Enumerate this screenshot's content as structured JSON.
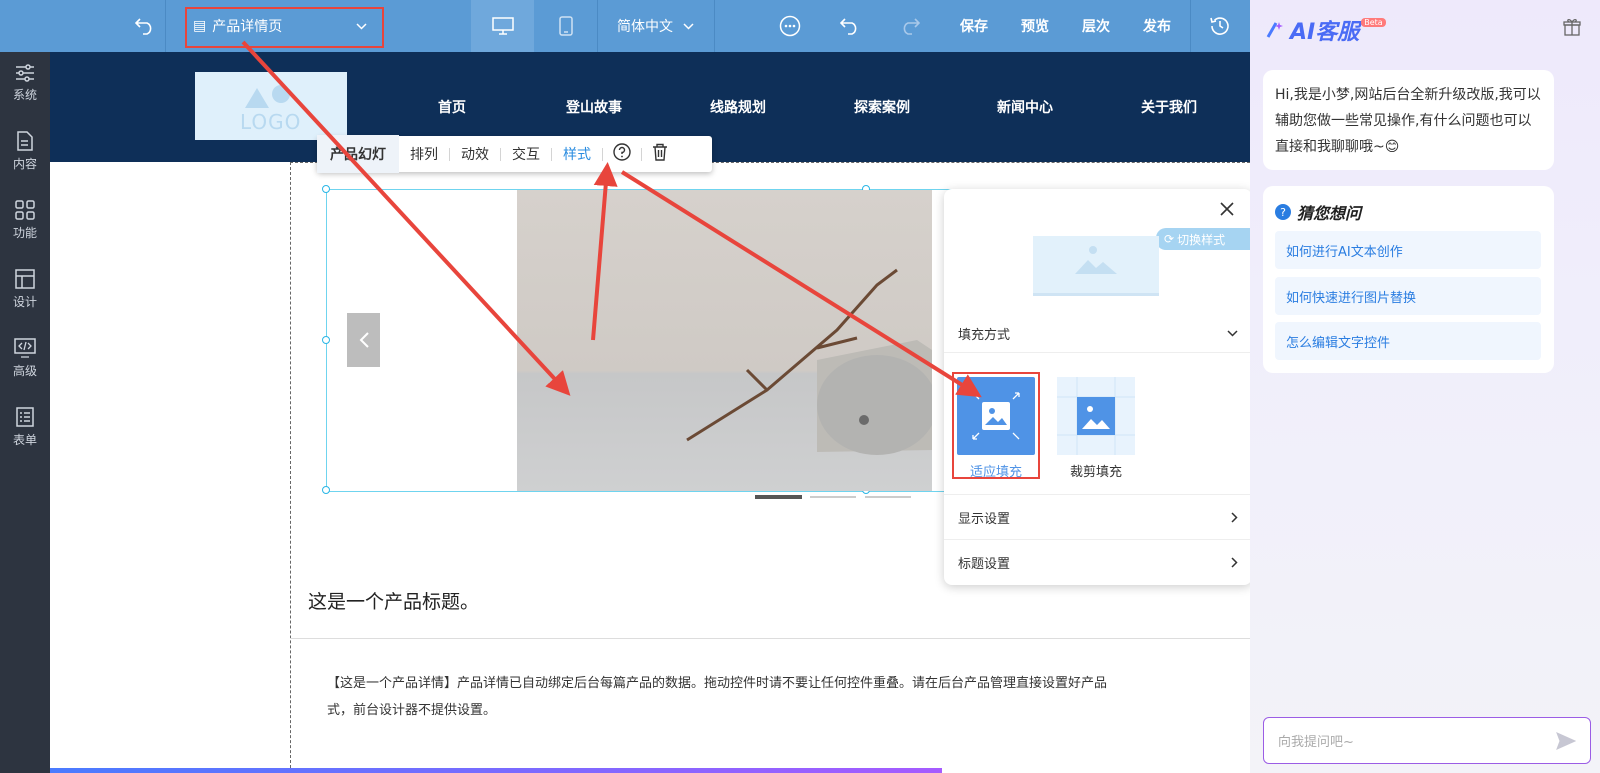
{
  "topbar": {
    "page_select": "产品详情页",
    "language": "简体中文",
    "save": "保存",
    "preview": "预览",
    "layers": "层次",
    "publish": "发布"
  },
  "sidebar": {
    "items": [
      {
        "label": "系统",
        "icon": "sliders-icon"
      },
      {
        "label": "内容",
        "icon": "document-icon"
      },
      {
        "label": "功能",
        "icon": "grid-icon"
      },
      {
        "label": "设计",
        "icon": "layout-icon"
      },
      {
        "label": "高级",
        "icon": "code-icon"
      },
      {
        "label": "表单",
        "icon": "list-icon"
      }
    ]
  },
  "site": {
    "logo": "LOGO",
    "nav": [
      "首页",
      "登山故事",
      "线路规划",
      "探索案例",
      "新闻中心",
      "关于我们"
    ],
    "product_title": "这是一个产品标题。",
    "product_detail_line1": "【这是一个产品详情】产品详情已自动绑定后台每篇产品的数据。拖动控件时请不要让任何控件重叠。请在后台产品管理直接设置好产品",
    "product_detail_line2": "式，前台设计器不提供设置。"
  },
  "toolbar": {
    "items": [
      "产品幻灯",
      "排列",
      "动效",
      "交互",
      "样式"
    ],
    "selected": "产品幻灯",
    "active": "样式"
  },
  "style_panel": {
    "switch_style": "切换样式",
    "fill_mode_label": "填充方式",
    "option_fit": "适应填充",
    "option_crop": "裁剪填充",
    "display_settings": "显示设置",
    "title_settings": "标题设置"
  },
  "ai": {
    "title": "AI客服",
    "badge": "Beta",
    "greeting": "Hi,我是小梦,网站后台全新升级改版,我可以辅助您做一些常见操作,有什么问题也可以直接和我聊聊哦~😊",
    "guess_title": "猜您想问",
    "questions": [
      "如何进行AI文本创作",
      "如何快速进行图片替换",
      "怎么编辑文字控件"
    ],
    "input_placeholder": "向我提问吧~"
  },
  "colors": {
    "topbar": "#5b9bd5",
    "sidebar": "#2d3440",
    "site_header": "#0e2f58",
    "accent": "#2a8ce0",
    "annotation": "#e8453c"
  }
}
